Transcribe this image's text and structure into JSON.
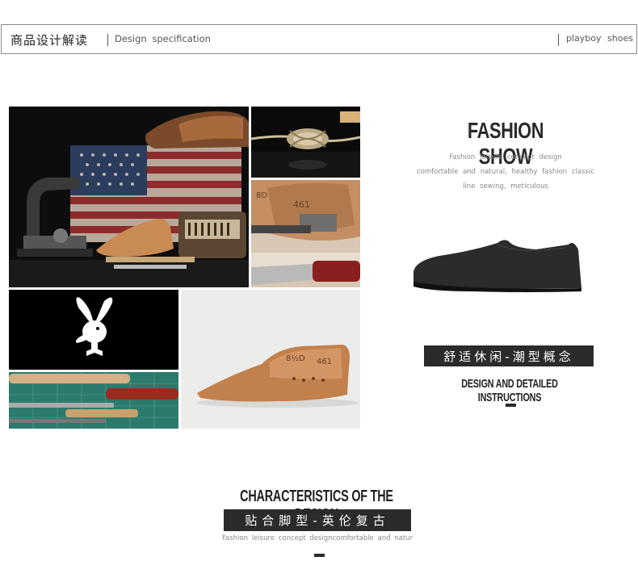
{
  "header": {
    "title_cn": "商品设计解读",
    "subtitle_en": "Design  specification",
    "brand": "playboy  shoes"
  },
  "fashion": {
    "title": "FASHION SHOW",
    "lines": [
      "Fashion  leisure  concept  design",
      "comfortable  and  natural,  healthy  fashion  classic",
      "line  sewing,  meticulous"
    ]
  },
  "badge1": "舒适休闲-潮型概念",
  "detail_title": "DESIGN AND DETAILED INSTRUCTIONS",
  "characteristics": {
    "title": "CHARACTERISTICS OF THE DESIGN",
    "badge": "贴合脚型-英伦复古",
    "line": "Fashion  leisure  concept  designcomfortable  and  natur"
  },
  "photo_text": {
    "last_number_a": "461",
    "last_number_b": "8D",
    "last_number_c": "8½D",
    "last_number_d": "461"
  },
  "colors": {
    "dark": "#2b2b2b",
    "muted": "#8a8a8a"
  }
}
